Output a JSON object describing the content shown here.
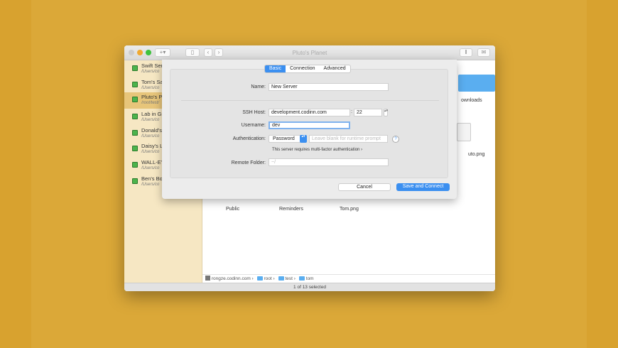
{
  "window": {
    "title": "Pluto's Planet"
  },
  "sidebar": {
    "items": [
      {
        "name": "Swift Ser",
        "path": "/Users/co"
      },
      {
        "name": "Tom's Sa",
        "path": "/Users/co"
      },
      {
        "name": "Pluto's P",
        "path": "/root/test/"
      },
      {
        "name": "Lab in Gr",
        "path": "/Users/co"
      },
      {
        "name": "Donald's",
        "path": "/Users/co"
      },
      {
        "name": "Daisy's L",
        "path": "/Users/co"
      },
      {
        "name": "WALL-E's",
        "path": "/Users/co"
      },
      {
        "name": "Ben's Bo",
        "path": "/Users/co"
      }
    ],
    "selected_index": 2
  },
  "files": {
    "items": [
      "Public",
      "Reminders",
      "Tom.png",
      "ownloads",
      "uto.png"
    ]
  },
  "pathbar": {
    "host": "rongze.codinn.com",
    "segments": [
      "root",
      "test",
      "tom"
    ]
  },
  "status": "1 of 13 selected",
  "sheet": {
    "tabs": [
      "Basic",
      "Connection",
      "Advanced"
    ],
    "active_tab": 0,
    "name_label": "Name:",
    "name_value": "New Server",
    "host_label": "SSH Host:",
    "host_value": "development.codinn.com",
    "port_sep": ":",
    "port_value": "22",
    "username_label": "Username:",
    "username_value": "dev",
    "auth_label": "Authentication:",
    "auth_value": "Password",
    "auth_placeholder": "Leave blank for runtime prompt",
    "help": "?",
    "mfa_link": "This server requires multi-factor authentication",
    "folder_label": "Remote Folder:",
    "folder_placeholder": "~/",
    "cancel": "Cancel",
    "save": "Save and Connect"
  }
}
